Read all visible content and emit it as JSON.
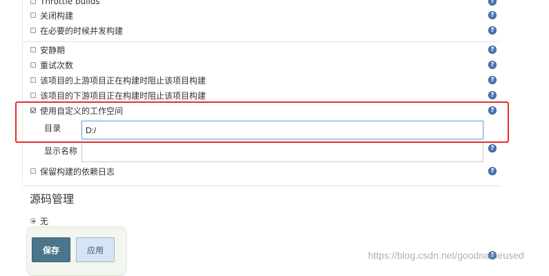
{
  "options_group_a": [
    {
      "label": "Throttle builds",
      "checked": false
    },
    {
      "label": "关闭构建",
      "checked": false
    },
    {
      "label": "在必要的时候并发构建",
      "checked": false
    }
  ],
  "options_group_b": [
    {
      "label": "安静期",
      "checked": false
    },
    {
      "label": "重试次数",
      "checked": false
    },
    {
      "label": "该项目的上游项目正在构建时阻止该项目构建",
      "checked": false
    },
    {
      "label": "该项目的下游项目正在构建时阻止该项目构建",
      "checked": false
    },
    {
      "label": "使用自定义的工作空间",
      "checked": true
    }
  ],
  "custom_workspace": {
    "directory_label": "目录",
    "directory_value": "D:/",
    "display_name_label": "显示名称",
    "display_name_value": ""
  },
  "keep_dependencies": {
    "label": "保留构建的依赖日志",
    "checked": false
  },
  "scm": {
    "title": "源码管理",
    "none_label": "无"
  },
  "buttons": {
    "save": "保存",
    "apply": "应用"
  },
  "help_icon_glyph": "?",
  "watermark": "https://blog.csdn.net/goodnameused",
  "colors": {
    "highlight_border": "#e52c2c",
    "save_button": "#4b758b",
    "apply_button": "#d6e4f3",
    "help_icon": "#4a78b5"
  }
}
